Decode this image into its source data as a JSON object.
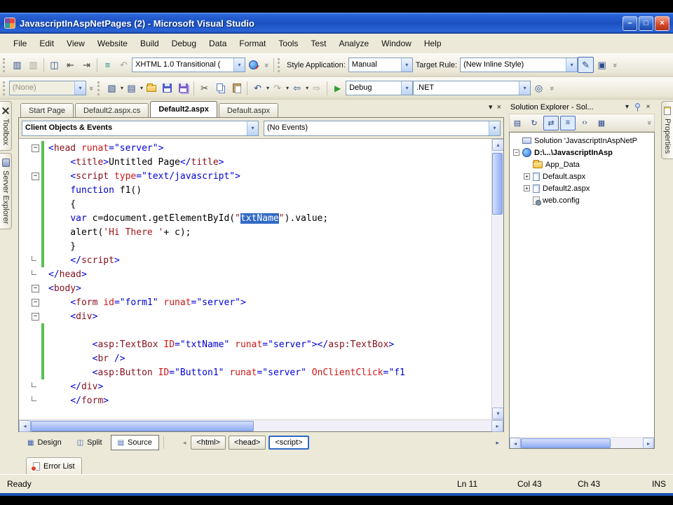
{
  "icons": {
    "dropdown": "▾",
    "close": "×",
    "minimize": "–",
    "maximize": "□",
    "overflow": "»",
    "format-document": "▥",
    "format-selection": "▥",
    "view-split": "◫",
    "outdent": "⇤",
    "indent": "⇥",
    "list": "≡",
    "undo": "↶",
    "redo": "↷",
    "pencil": "✎",
    "style-sheet": "▣",
    "new-project": "▧",
    "add-item": "▤",
    "cut": "✂",
    "nav-back": "⇦",
    "nav-fwd": "⇨",
    "play": "▶",
    "mag": "◎",
    "props": "▤",
    "refresh": "↻",
    "copy-web": "⇄",
    "nest": "≡",
    "view-code": "‹›",
    "view-design": "▦",
    "view-source": "▤",
    "scroll-up": "▴",
    "scroll-down": "▾",
    "scroll-left": "◂",
    "scroll-right": "▸",
    "back": "◂",
    "fwd": "▸"
  },
  "titlebar": {
    "title": "JavascriptInAspNetPages (2) - Microsoft Visual Studio"
  },
  "menubar": [
    "File",
    "Edit",
    "View",
    "Website",
    "Build",
    "Debug",
    "Data",
    "Format",
    "Tools",
    "Test",
    "Analyze",
    "Window",
    "Help"
  ],
  "toolbars": {
    "doctype_combo": "XHTML 1.0 Transitional (",
    "style_application_label": "Style Application:",
    "style_application_value": "Manual",
    "target_rule_label": "Target Rule:",
    "target_rule_value": "(New Inline Style)",
    "font_combo": "(None)",
    "config_combo": "Debug",
    "framework_combo": ".NET"
  },
  "document_tabs": [
    {
      "label": "Start Page",
      "active": false
    },
    {
      "label": "Default2.aspx.cs",
      "active": false
    },
    {
      "label": "Default2.aspx",
      "active": true
    },
    {
      "label": "Default.aspx",
      "active": false
    }
  ],
  "editor": {
    "object_combo": "Client Objects & Events",
    "event_combo": "(No Events)",
    "lines": [
      {
        "m": "minus",
        "g": true,
        "s": [
          [
            "d",
            "<"
          ],
          [
            "e",
            "head"
          ],
          [
            "p",
            " "
          ],
          [
            "a",
            "runat"
          ],
          [
            "d",
            "="
          ],
          [
            "v",
            "\"server\""
          ],
          [
            "d",
            ">"
          ]
        ]
      },
      {
        "m": null,
        "g": true,
        "s": [
          [
            "p",
            "    "
          ],
          [
            "d",
            "<"
          ],
          [
            "e",
            "title"
          ],
          [
            "d",
            ">"
          ],
          [
            "p",
            "Untitled Page"
          ],
          [
            "d",
            "</"
          ],
          [
            "e",
            "title"
          ],
          [
            "d",
            ">"
          ]
        ]
      },
      {
        "m": "minus",
        "g": true,
        "s": [
          [
            "p",
            "    "
          ],
          [
            "d",
            "<"
          ],
          [
            "e",
            "script"
          ],
          [
            "p",
            " "
          ],
          [
            "a",
            "type"
          ],
          [
            "d",
            "="
          ],
          [
            "v",
            "\"text/javascript\""
          ],
          [
            "d",
            ">"
          ]
        ]
      },
      {
        "m": null,
        "g": true,
        "s": [
          [
            "p",
            "    "
          ],
          [
            "k",
            "function"
          ],
          [
            "p",
            " f1()"
          ]
        ]
      },
      {
        "m": null,
        "g": true,
        "s": [
          [
            "p",
            "    {"
          ]
        ]
      },
      {
        "m": null,
        "g": true,
        "s": [
          [
            "p",
            "    "
          ],
          [
            "k",
            "var"
          ],
          [
            "p",
            " c=document.getElementById("
          ],
          [
            "s",
            "\""
          ],
          [
            "sel",
            "txtName"
          ],
          [
            "s",
            "\""
          ],
          [
            "p",
            ").value;"
          ]
        ]
      },
      {
        "m": null,
        "g": true,
        "s": [
          [
            "p",
            "    alert("
          ],
          [
            "s",
            "'Hi There '"
          ],
          [
            "p",
            "+ c);"
          ]
        ]
      },
      {
        "m": null,
        "g": true,
        "s": [
          [
            "p",
            "    }"
          ]
        ]
      },
      {
        "m": "end",
        "g": true,
        "s": [
          [
            "p",
            "    "
          ],
          [
            "d",
            "</"
          ],
          [
            "e",
            "script"
          ],
          [
            "d",
            ">"
          ]
        ]
      },
      {
        "m": "end",
        "g": false,
        "s": [
          [
            "d",
            "</"
          ],
          [
            "e",
            "head"
          ],
          [
            "d",
            ">"
          ]
        ]
      },
      {
        "m": "minus",
        "g": false,
        "s": [
          [
            "d",
            "<"
          ],
          [
            "e",
            "body"
          ],
          [
            "d",
            ">"
          ]
        ]
      },
      {
        "m": "minus",
        "g": false,
        "s": [
          [
            "p",
            "    "
          ],
          [
            "d",
            "<"
          ],
          [
            "e",
            "form"
          ],
          [
            "p",
            " "
          ],
          [
            "a",
            "id"
          ],
          [
            "d",
            "="
          ],
          [
            "v",
            "\"form1\""
          ],
          [
            "p",
            " "
          ],
          [
            "a",
            "runat"
          ],
          [
            "d",
            "="
          ],
          [
            "v",
            "\"server\""
          ],
          [
            "d",
            ">"
          ]
        ]
      },
      {
        "m": "minus",
        "g": false,
        "s": [
          [
            "p",
            "    "
          ],
          [
            "d",
            "<"
          ],
          [
            "e",
            "div"
          ],
          [
            "d",
            ">"
          ]
        ]
      },
      {
        "m": null,
        "g": true,
        "s": []
      },
      {
        "m": null,
        "g": true,
        "s": [
          [
            "p",
            "        "
          ],
          [
            "d",
            "<"
          ],
          [
            "e",
            "asp:TextBox"
          ],
          [
            "p",
            " "
          ],
          [
            "a",
            "ID"
          ],
          [
            "d",
            "="
          ],
          [
            "v",
            "\"txtName\""
          ],
          [
            "p",
            " "
          ],
          [
            "a",
            "runat"
          ],
          [
            "d",
            "="
          ],
          [
            "v",
            "\"server\""
          ],
          [
            "d",
            "></"
          ],
          [
            "e",
            "asp:TextBox"
          ],
          [
            "d",
            ">"
          ]
        ]
      },
      {
        "m": null,
        "g": true,
        "s": [
          [
            "p",
            "        "
          ],
          [
            "d",
            "<"
          ],
          [
            "e",
            "br"
          ],
          [
            "d",
            " />"
          ]
        ]
      },
      {
        "m": null,
        "g": true,
        "s": [
          [
            "p",
            "        "
          ],
          [
            "d",
            "<"
          ],
          [
            "e",
            "asp:Button"
          ],
          [
            "p",
            " "
          ],
          [
            "a",
            "ID"
          ],
          [
            "d",
            "="
          ],
          [
            "v",
            "\"Button1\""
          ],
          [
            "p",
            " "
          ],
          [
            "a",
            "runat"
          ],
          [
            "d",
            "="
          ],
          [
            "v",
            "\"server\""
          ],
          [
            "p",
            " "
          ],
          [
            "a",
            "OnClientClick"
          ],
          [
            "d",
            "="
          ],
          [
            "v",
            "\"f1"
          ]
        ]
      },
      {
        "m": "end",
        "g": false,
        "s": [
          [
            "p",
            "    "
          ],
          [
            "d",
            "</"
          ],
          [
            "e",
            "div"
          ],
          [
            "d",
            ">"
          ]
        ]
      },
      {
        "m": "end",
        "g": false,
        "s": [
          [
            "p",
            "    "
          ],
          [
            "d",
            "</"
          ],
          [
            "e",
            "form"
          ],
          [
            "d",
            ">"
          ]
        ]
      }
    ]
  },
  "solution_explorer": {
    "title": "Solution Explorer - Sol...",
    "items": [
      {
        "indent": 0,
        "expand": null,
        "icon_class": "gi-solution",
        "icon_name": "solution-icon",
        "label": "Solution 'JavascriptInAspNetP",
        "bold": false
      },
      {
        "indent": 0,
        "expand": "minus",
        "icon_class": "gi-globe",
        "icon_name": "website-icon",
        "label": "D:\\...\\JavascriptInAsp",
        "bold": true
      },
      {
        "indent": 1,
        "expand": null,
        "icon_class": "gi-folder",
        "icon_name": "folder-icon",
        "label": "App_Data",
        "bold": false
      },
      {
        "indent": 1,
        "expand": "plus",
        "icon_class": "gi-page",
        "icon_name": "aspx-page-icon",
        "label": "Default.aspx",
        "bold": false
      },
      {
        "indent": 1,
        "expand": "plus",
        "icon_class": "gi-page",
        "icon_name": "aspx-page-icon",
        "label": "Default2.aspx",
        "bold": false
      },
      {
        "indent": 1,
        "expand": null,
        "icon_class": "gi-gearpage",
        "icon_name": "web-config-icon",
        "label": "web.config",
        "bold": false
      }
    ]
  },
  "left_tabs": [
    {
      "label": "Toolbox",
      "icon_class": "gi-tools",
      "icon_name": "toolbox-icon"
    },
    {
      "label": "Server Explorer",
      "icon_class": "gi-server",
      "icon_name": "server-explorer-icon"
    }
  ],
  "right_tabs": [
    {
      "label": "Properties",
      "icon_class": "gi-props",
      "icon_name": "properties-icon"
    }
  ],
  "view_buttons": [
    {
      "label": "Design",
      "icon": "view-design",
      "active": false
    },
    {
      "label": "Split",
      "icon": "view-split",
      "active": false
    },
    {
      "label": "Source",
      "icon": "view-source",
      "active": true
    }
  ],
  "breadcrumb": [
    {
      "label": "<html>",
      "active": false
    },
    {
      "label": "<head>",
      "active": false
    },
    {
      "label": "<script>",
      "active": true
    }
  ],
  "error_list": {
    "label": "Error List"
  },
  "status": {
    "ready": "Ready",
    "ln": "Ln 11",
    "col": "Col 43",
    "ch": "Ch 43",
    "mode": "INS"
  },
  "colors": {
    "titlebar_blue": "#1b50c0",
    "selection_blue": "#316ac5",
    "change_bar_green": "#55c24e",
    "code_element": "#87101c",
    "code_attribute": "#d01515",
    "code_value": "#0000d8",
    "code_keyword": "#0000c8",
    "code_string": "#a31515",
    "chrome": "#ece9d8"
  }
}
